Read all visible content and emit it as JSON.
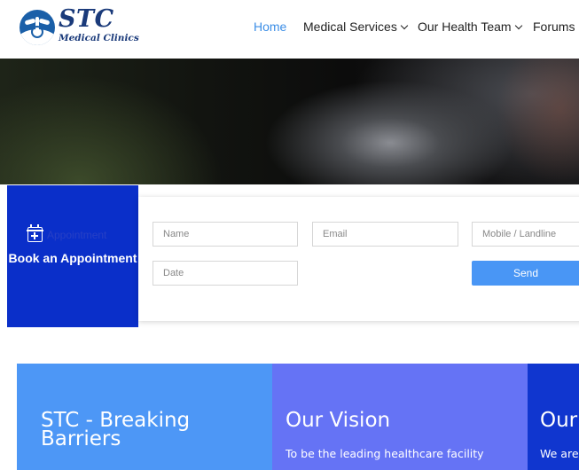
{
  "header": {
    "logo_title": "STC",
    "logo_subtitle": "Medical Clinics",
    "nav": [
      {
        "label": "Home"
      },
      {
        "label": "Medical Services"
      },
      {
        "label": "Our Health Team"
      },
      {
        "label": "Forums"
      }
    ],
    "active_color": "#3c8ee6"
  },
  "appointment": {
    "ghost_label": "Appointment",
    "title": "Book an Appointment",
    "fields": {
      "name_placeholder": "Name",
      "email_placeholder": "Email",
      "mobile_placeholder": "Mobile / Landline",
      "date_placeholder": "Date"
    },
    "send_label": "Send",
    "tab_color": "#0a2fc9",
    "send_color": "#4996f5"
  },
  "panels": [
    {
      "title": "STC - Breaking\nBarriers",
      "text": "",
      "color": "#4d97f6"
    },
    {
      "title": "Our Vision",
      "text": "To be the leading healthcare facility",
      "color": "#6573f5"
    },
    {
      "title": "Our",
      "text": "We are",
      "color": "#1036cf"
    }
  ]
}
